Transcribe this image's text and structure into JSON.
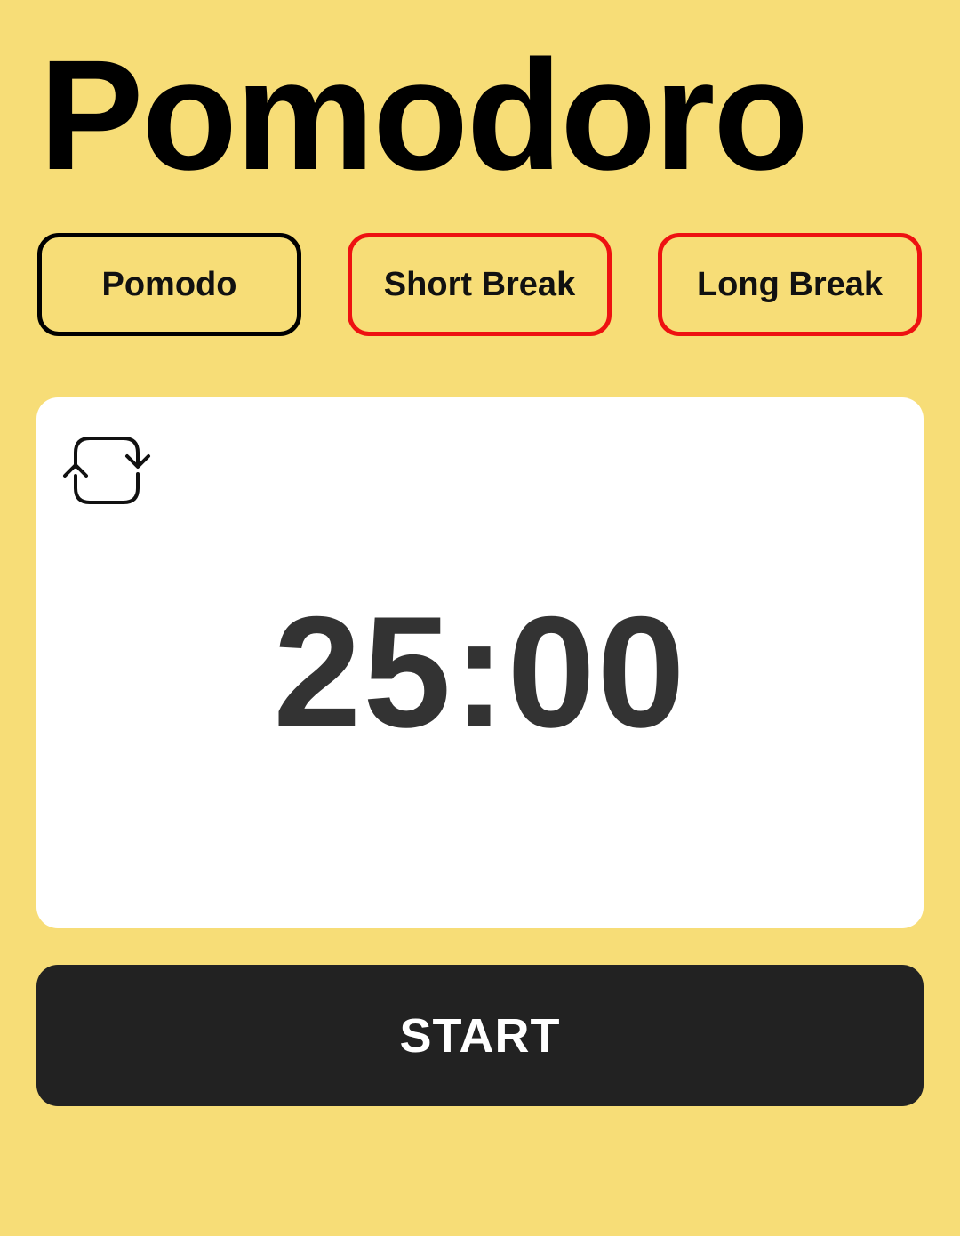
{
  "app": {
    "title": "Pomodoro"
  },
  "tabs": [
    {
      "label": "Pomodo",
      "active": true
    },
    {
      "label": "Short Break",
      "active": false
    },
    {
      "label": "Long Break",
      "active": false
    }
  ],
  "timer": {
    "display": "25:00",
    "reset_icon": "refresh-icon"
  },
  "controls": {
    "start_label": "START"
  },
  "colors": {
    "background": "#f7dd77",
    "card": "#ffffff",
    "active_tab_border": "#000000",
    "inactive_tab_border": "#ee1111",
    "start_button": "#222222",
    "timer_text": "#333333"
  }
}
